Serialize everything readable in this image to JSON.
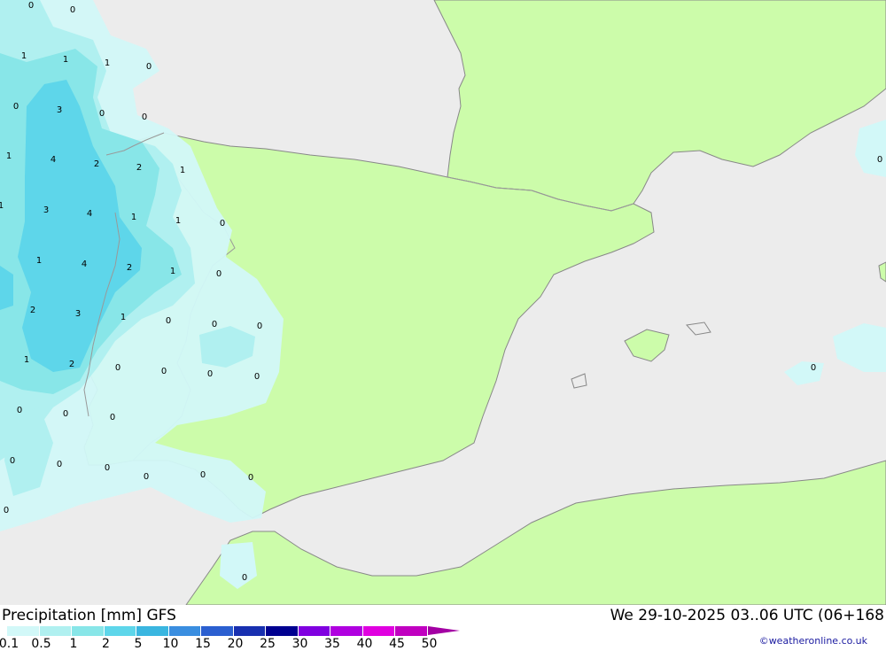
{
  "title": "Precipitation [mm]  GFS",
  "datetime": "We 29-10-2025 03..06 UTC (06+168",
  "credit": "©weatheronline.co.uk",
  "legend": {
    "ticks": [
      "0.1",
      "0.5",
      "1",
      "2",
      "5",
      "10",
      "15",
      "20",
      "25",
      "30",
      "35",
      "40",
      "45",
      "50"
    ],
    "colors": [
      "#d2f8f8",
      "#b0f0f0",
      "#88e6e8",
      "#5ed6ea",
      "#3ab6e0",
      "#3a8ee0",
      "#2b5fd0",
      "#1830b0",
      "#000090",
      "#8000e0",
      "#b000e0",
      "#e000e0",
      "#c000c0",
      "#a300a3"
    ]
  },
  "map_colors": {
    "sea": "#ececec",
    "land": "#ccfcaa",
    "border": "#888888"
  },
  "map_values": [
    "0",
    "0",
    "1",
    "1",
    "1",
    "0",
    "0",
    "3",
    "0",
    "0",
    "1",
    "4",
    "2",
    "2",
    "1",
    "1",
    "3",
    "4",
    "1",
    "1",
    "0",
    "1",
    "4",
    "2",
    "1",
    "0",
    "2",
    "3",
    "1",
    "0",
    "0",
    "0",
    "1",
    "2",
    "0",
    "0",
    "0",
    "0",
    "0",
    "0",
    "0",
    "0",
    "0",
    "0",
    "0",
    "0",
    "0",
    "0",
    "0",
    "0",
    "0"
  ]
}
